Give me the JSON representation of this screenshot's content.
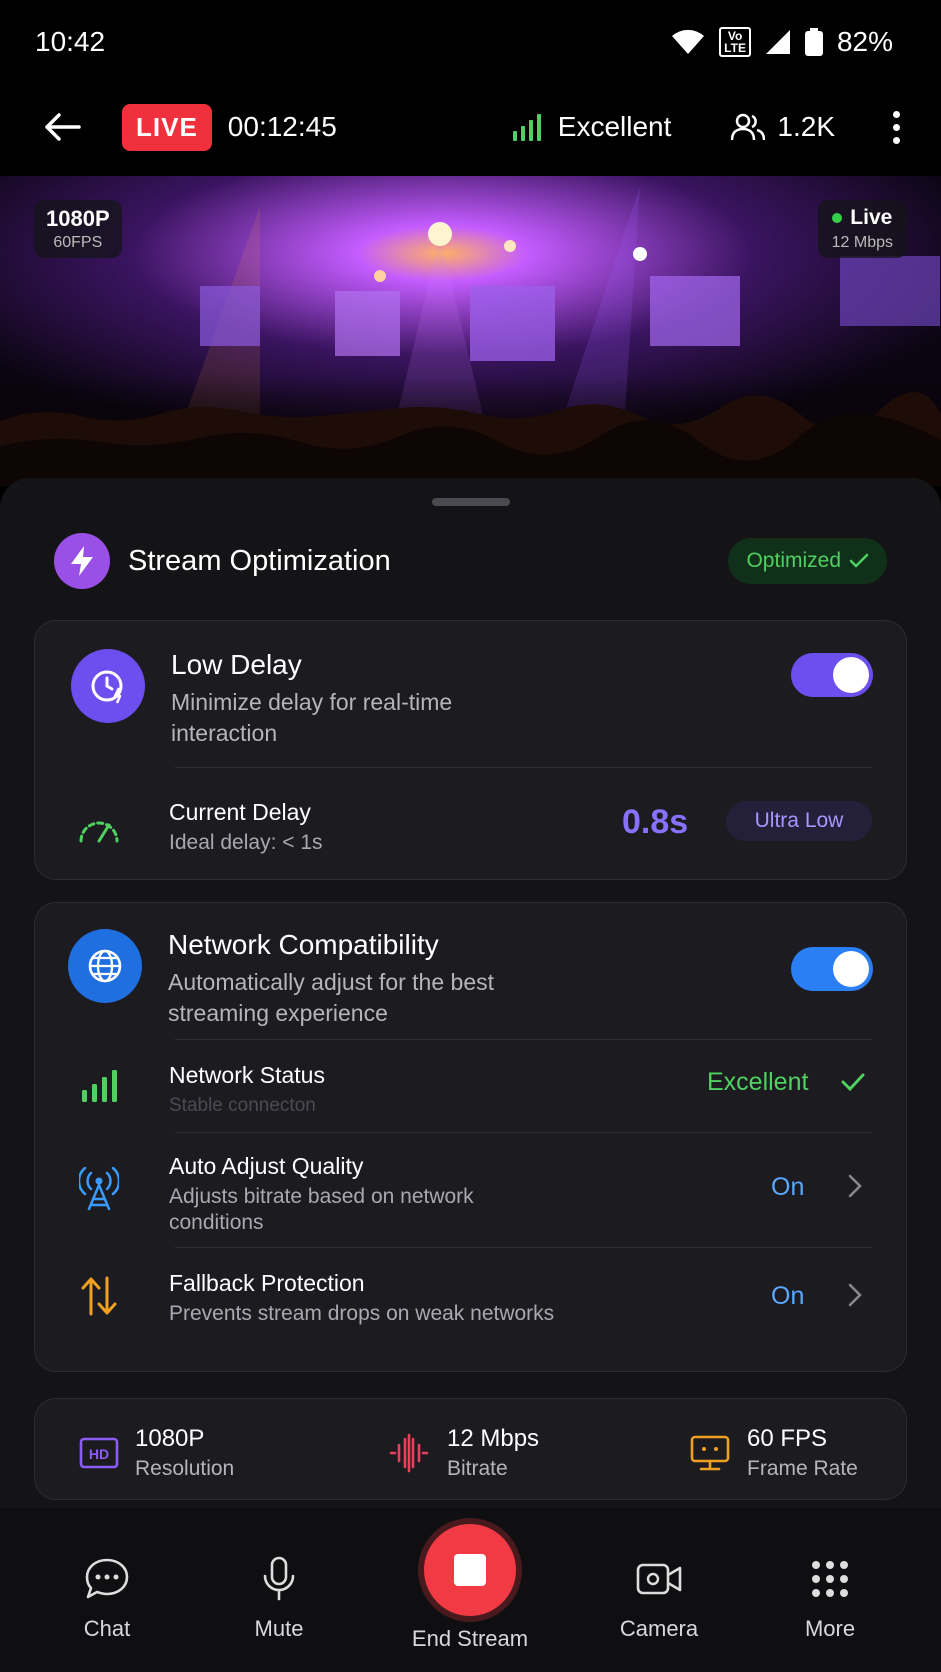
{
  "status_bar": {
    "time": "10:42",
    "volte_top": "Vo",
    "volte_bottom": "LTE",
    "battery": "82%"
  },
  "header": {
    "live_label": "LIVE",
    "timer": "00:12:45",
    "connection": "Excellent",
    "viewers": "1.2K"
  },
  "video": {
    "resolution": "1080P",
    "fps": "60FPS",
    "live_label": "Live",
    "bitrate": "12 Mbps"
  },
  "optimization": {
    "title": "Stream Optimization",
    "status": "Optimized",
    "low_delay": {
      "title": "Low Delay",
      "description": "Minimize delay for real-time interaction",
      "enabled": true,
      "current_delay_label": "Current Delay",
      "ideal_delay": "Ideal delay: < 1s",
      "delay_value": "0.8s",
      "delay_badge": "Ultra Low"
    },
    "network": {
      "title": "Network Compatibility",
      "description": "Automatically adjust for the best streaming experience",
      "enabled": true,
      "status_label": "Network Status",
      "status_sub": "Stable connecton",
      "status_value": "Excellent",
      "auto_title": "Auto Adjust Quality",
      "auto_sub": "Adjusts bitrate based on network conditions",
      "auto_value": "On",
      "fallback_title": "Fallback Protection",
      "fallback_sub": "Prevents stream drops on weak networks",
      "fallback_value": "On"
    }
  },
  "stats": [
    {
      "icon": "hd-icon",
      "value": "1080P",
      "label": "Resolution",
      "color": "#8b5cf6"
    },
    {
      "icon": "bitrate-icon",
      "value": "12 Mbps",
      "label": "Bitrate",
      "color": "#e8405a"
    },
    {
      "icon": "frame-rate-icon",
      "value": "60 FPS",
      "label": "Frame Rate",
      "color": "#f0a020"
    }
  ],
  "bottom_nav": {
    "chat": "Chat",
    "mute": "Mute",
    "end": "End Stream",
    "camera": "Camera",
    "more": "More"
  },
  "colors": {
    "accent_purple": "#6d4ff0",
    "accent_blue": "#2b7ff5",
    "success_green": "#4fd060",
    "live_red": "#f0303c",
    "info_blue": "#5aa8ff"
  }
}
